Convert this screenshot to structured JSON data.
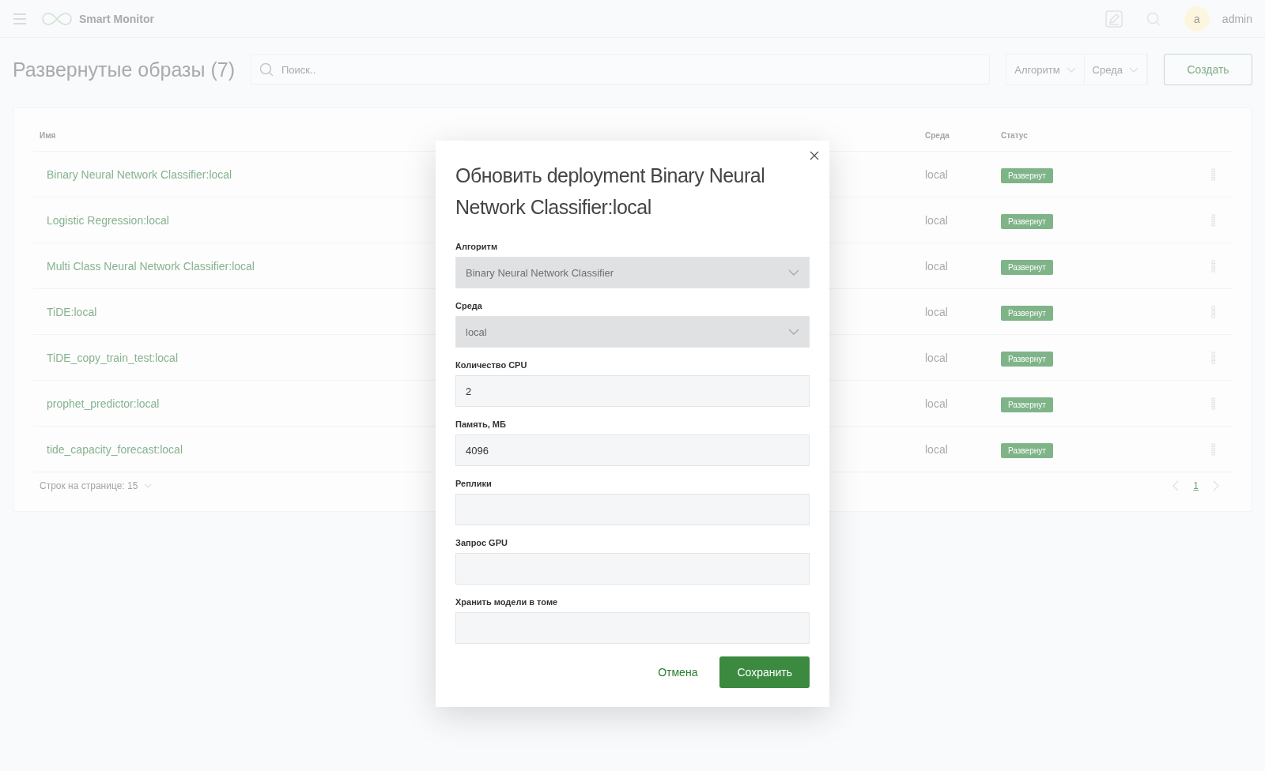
{
  "app": {
    "title": "Smart Monitor",
    "user_initial": "a",
    "user_name": "admin"
  },
  "page": {
    "title": "Развернутые образы (7)",
    "search": {
      "placeholder": "Поиск.."
    },
    "filters": [
      "Алгоритм",
      "Среда"
    ],
    "create_button": "Создать"
  },
  "table": {
    "columns": [
      "Имя",
      "Среда",
      "Статус"
    ],
    "rows": [
      {
        "name": "Binary Neural Network Classifier:local",
        "env": "local",
        "status": "Развернут"
      },
      {
        "name": "Logistic Regression:local",
        "env": "local",
        "status": "Развернут"
      },
      {
        "name": "Multi Class Neural Network Classifier:local",
        "env": "local",
        "status": "Развернут"
      },
      {
        "name": "TiDE:local",
        "env": "local",
        "status": "Развернут"
      },
      {
        "name": "TiDE_copy_train_test:local",
        "env": "local",
        "status": "Развернут"
      },
      {
        "name": "prophet_predictor:local",
        "env": "local",
        "status": "Развернут"
      },
      {
        "name": "tide_capacity_forecast:local",
        "env": "local",
        "status": "Развернут"
      }
    ],
    "rows_per_page": "Строк на странице: 15",
    "pages": [
      {
        "label": "1",
        "selected": true
      }
    ]
  },
  "dialog": {
    "title": "Обновить deployment Binary Neural Network Classifier:local",
    "fields": [
      {
        "kind": "select",
        "label": "Алгоритм",
        "value": "Binary Neural Network Classifier",
        "disabled": true
      },
      {
        "kind": "select",
        "label": "Среда",
        "value": "local",
        "disabled": true
      },
      {
        "kind": "input",
        "label": "Количество CPU",
        "value": "2",
        "disabled": false
      },
      {
        "kind": "input",
        "label": "Память, МБ",
        "value": "4096",
        "disabled": false
      },
      {
        "kind": "input",
        "label": "Реплики",
        "disabled": false
      },
      {
        "kind": "input",
        "label": "Запрос GPU",
        "disabled": false
      },
      {
        "kind": "input",
        "label": "Хранить модели в томе",
        "disabled": false
      }
    ],
    "cancel_button": "Отмена",
    "save_button": "Сохранить"
  }
}
